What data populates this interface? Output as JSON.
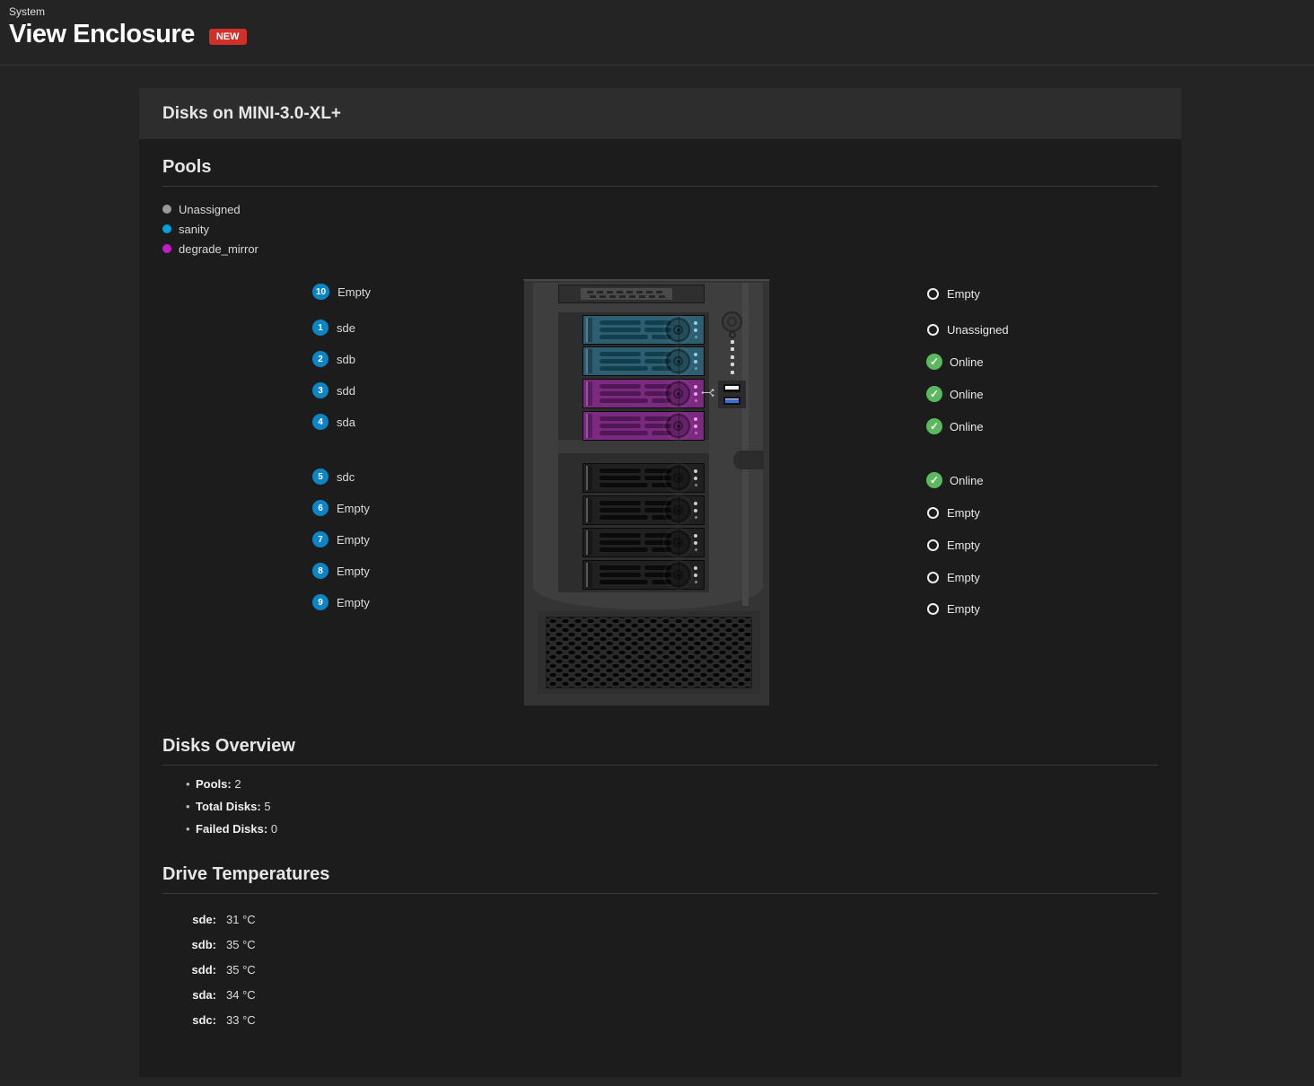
{
  "page": {
    "breadcrumb": "System",
    "title": "View Enclosure",
    "badge": "NEW"
  },
  "card": {
    "title": "Disks on MINI-3.0-XL+"
  },
  "colors": {
    "new_badge_red": "#d02f2a",
    "slot_badge_blue": "#0d85c4",
    "online_green": "#5cb85c"
  },
  "icons": {
    "online_check": "✓",
    "usb_symbol": "usb-trident"
  },
  "pools": {
    "heading": "Pools",
    "legend": [
      {
        "label": "Unassigned",
        "color": "#9a9a9a"
      },
      {
        "label": "sanity",
        "color": "#00a1dc"
      },
      {
        "label": "degrade_mirror",
        "color": "#c71bc7"
      }
    ]
  },
  "slots": {
    "left_top": [
      {
        "num": "10",
        "label": "Empty"
      },
      {
        "num": "1",
        "label": "sde"
      },
      {
        "num": "2",
        "label": "sdb"
      },
      {
        "num": "3",
        "label": "sdd"
      },
      {
        "num": "4",
        "label": "sda"
      }
    ],
    "left_bottom": [
      {
        "num": "5",
        "label": "sdc"
      },
      {
        "num": "6",
        "label": "Empty"
      },
      {
        "num": "7",
        "label": "Empty"
      },
      {
        "num": "8",
        "label": "Empty"
      },
      {
        "num": "9",
        "label": "Empty"
      }
    ],
    "right_top": [
      {
        "status": "Empty",
        "state": "empty"
      },
      {
        "status": "Unassigned",
        "state": "empty"
      },
      {
        "status": "Online",
        "state": "online"
      },
      {
        "status": "Online",
        "state": "online"
      },
      {
        "status": "Online",
        "state": "online"
      }
    ],
    "right_bottom": [
      {
        "status": "Online",
        "state": "online"
      },
      {
        "status": "Empty",
        "state": "empty"
      },
      {
        "status": "Empty",
        "state": "empty"
      },
      {
        "status": "Empty",
        "state": "empty"
      },
      {
        "status": "Empty",
        "state": "empty"
      }
    ]
  },
  "enclosure": {
    "bays_top": [
      {
        "slot": 1,
        "pool": "sanity"
      },
      {
        "slot": 2,
        "pool": "sanity"
      },
      {
        "slot": 3,
        "pool": "degrade_mirror"
      },
      {
        "slot": 4,
        "pool": "degrade_mirror"
      }
    ],
    "bays_bottom": [
      {
        "slot": 5,
        "pool": "none"
      },
      {
        "slot": 6,
        "pool": "none"
      },
      {
        "slot": 7,
        "pool": "none"
      },
      {
        "slot": 8,
        "pool": "none"
      }
    ],
    "tray_tints": {
      "sanity": {
        "base": "#2d5e71",
        "dark": "#123f4d",
        "led": "#8ed2e8"
      },
      "degrade_mirror": {
        "base": "#7c2a81",
        "dark": "#4f1754",
        "led": "#e9a6e9"
      },
      "none": {
        "base": "#202020",
        "dark": "#0a0a0a",
        "led": "#cccccc"
      }
    }
  },
  "overview": {
    "heading": "Disks Overview",
    "items": [
      {
        "label": "Pools:",
        "value": "2"
      },
      {
        "label": "Total Disks:",
        "value": "5"
      },
      {
        "label": "Failed Disks:",
        "value": "0"
      }
    ]
  },
  "temperatures": {
    "heading": "Drive Temperatures",
    "rows": [
      {
        "label": "sde:",
        "value": "31 °C"
      },
      {
        "label": "sdb:",
        "value": "35 °C"
      },
      {
        "label": "sdd:",
        "value": "35 °C"
      },
      {
        "label": "sda:",
        "value": "34 °C"
      },
      {
        "label": "sdc:",
        "value": "33 °C"
      }
    ]
  }
}
